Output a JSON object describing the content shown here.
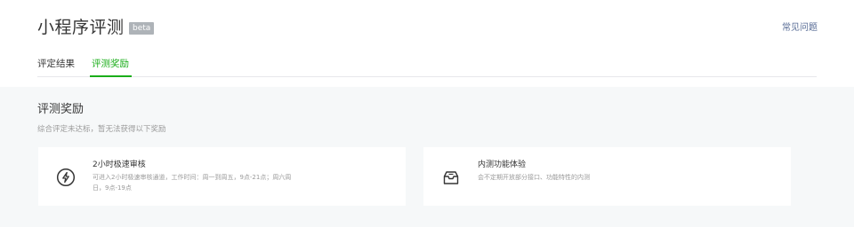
{
  "header": {
    "title": "小程序评测",
    "badge": "beta",
    "faq_link": "常见问题"
  },
  "tabs": [
    {
      "label": "评定结果",
      "active": false
    },
    {
      "label": "评测奖励",
      "active": true
    }
  ],
  "reward_section": {
    "title": "评测奖励",
    "description": "综合评定未达标，暂无法获得以下奖励",
    "cards": [
      {
        "icon": "lightning-icon",
        "name": "2小时极速审核",
        "description": "可进入2小时极速审核通道，工作时间：周一到周五，9点-21点；周六周日，9点-19点"
      },
      {
        "icon": "mailbox-icon",
        "name": "内测功能体验",
        "description": "会不定期开放部分接口、功能特性的内测"
      }
    ]
  },
  "colors": {
    "accent_green": "#1aad19",
    "link_blue": "#576b95",
    "badge_gray": "#aeb3b8",
    "background_gray": "#f6f8f9"
  }
}
